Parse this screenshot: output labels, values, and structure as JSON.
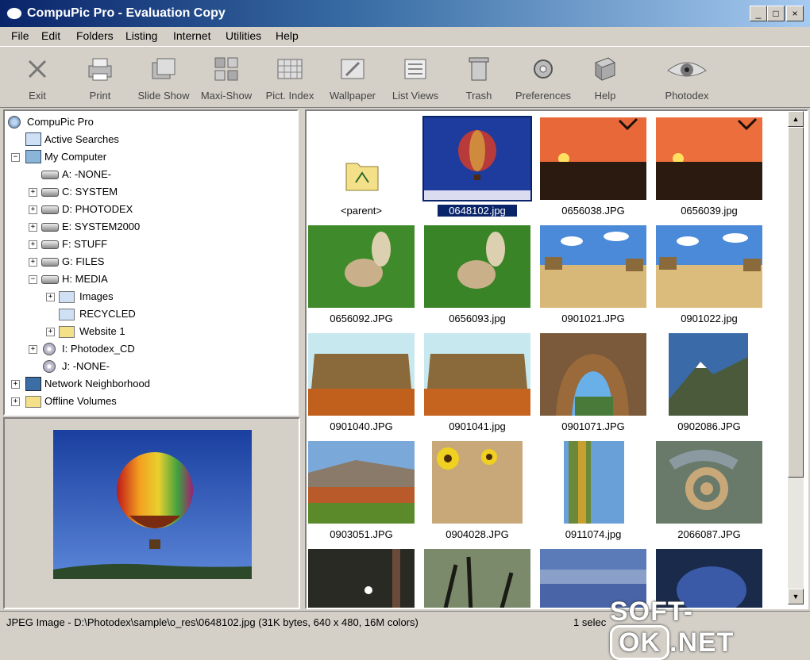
{
  "window": {
    "title": "CompuPic Pro - Evaluation Copy",
    "min": "_",
    "max": "□",
    "close": "×"
  },
  "menu": [
    "File",
    "Edit",
    "Folders",
    "Listing",
    "Internet",
    "Utilities",
    "Help"
  ],
  "toolbar": [
    {
      "label": "Exit",
      "icon": "exit-icon"
    },
    {
      "label": "Print",
      "icon": "print-icon"
    },
    {
      "label": "Slide Show",
      "icon": "slide-show-icon"
    },
    {
      "label": "Maxi-Show",
      "icon": "maxi-show-icon"
    },
    {
      "label": "Pict. Index",
      "icon": "picture-index-icon"
    },
    {
      "label": "Wallpaper",
      "icon": "wallpaper-icon"
    },
    {
      "label": "List Views",
      "icon": "list-views-icon"
    },
    {
      "label": "Trash",
      "icon": "trash-icon"
    },
    {
      "label": "Preferences",
      "icon": "preferences-icon"
    },
    {
      "label": "Help",
      "icon": "help-book-icon"
    },
    {
      "label": "Photodex",
      "icon": "photodex-eye-icon"
    }
  ],
  "tree": [
    {
      "label": "CompuPic Pro"
    },
    {
      "label": "Active Searches"
    },
    {
      "label": "My Computer",
      "expander": "−"
    },
    {
      "label": "A:   -NONE-"
    },
    {
      "label": "C:  SYSTEM",
      "expander": "+"
    },
    {
      "label": "D:  PHOTODEX",
      "expander": "+"
    },
    {
      "label": "E:  SYSTEM2000",
      "expander": "+"
    },
    {
      "label": "F:  STUFF",
      "expander": "+"
    },
    {
      "label": "G:  FILES",
      "expander": "+"
    },
    {
      "label": "H:  MEDIA",
      "expander": "−"
    },
    {
      "label": "Images",
      "expander": "+"
    },
    {
      "label": "RECYCLED"
    },
    {
      "label": "Website 1",
      "expander": "+"
    },
    {
      "label": "I:  Photodex_CD",
      "expander": "+"
    },
    {
      "label": "J:   -NONE-"
    },
    {
      "label": "Network Neighborhood",
      "expander": "+"
    },
    {
      "label": "Offline Volumes",
      "expander": "+"
    }
  ],
  "thumbnails": [
    {
      "caption": "<parent>"
    },
    {
      "caption": "0648102.jpg",
      "selected": true
    },
    {
      "caption": "0656038.JPG"
    },
    {
      "caption": "0656039.jpg"
    },
    {
      "caption": "0656092.JPG"
    },
    {
      "caption": "0656093.jpg"
    },
    {
      "caption": "0901021.JPG"
    },
    {
      "caption": "0901022.jpg"
    },
    {
      "caption": "0901040.JPG"
    },
    {
      "caption": "0901041.jpg"
    },
    {
      "caption": "0901071.JPG"
    },
    {
      "caption": "0902086.JPG"
    },
    {
      "caption": "0903051.JPG"
    },
    {
      "caption": "0904028.JPG"
    },
    {
      "caption": "0911074.jpg"
    },
    {
      "caption": "2066087.JPG"
    },
    {
      "caption": ""
    },
    {
      "caption": ""
    },
    {
      "caption": ""
    },
    {
      "caption": ""
    }
  ],
  "status": {
    "info": "JPEG Image - D:\\Photodex\\sample\\o_res\\0648102.jpg  (31K bytes, 640 x 480, 16M colors)",
    "selection": "1 selec"
  },
  "watermark": {
    "prefix": "SOFT-",
    "box": "OK",
    "suffix": ".NET"
  }
}
